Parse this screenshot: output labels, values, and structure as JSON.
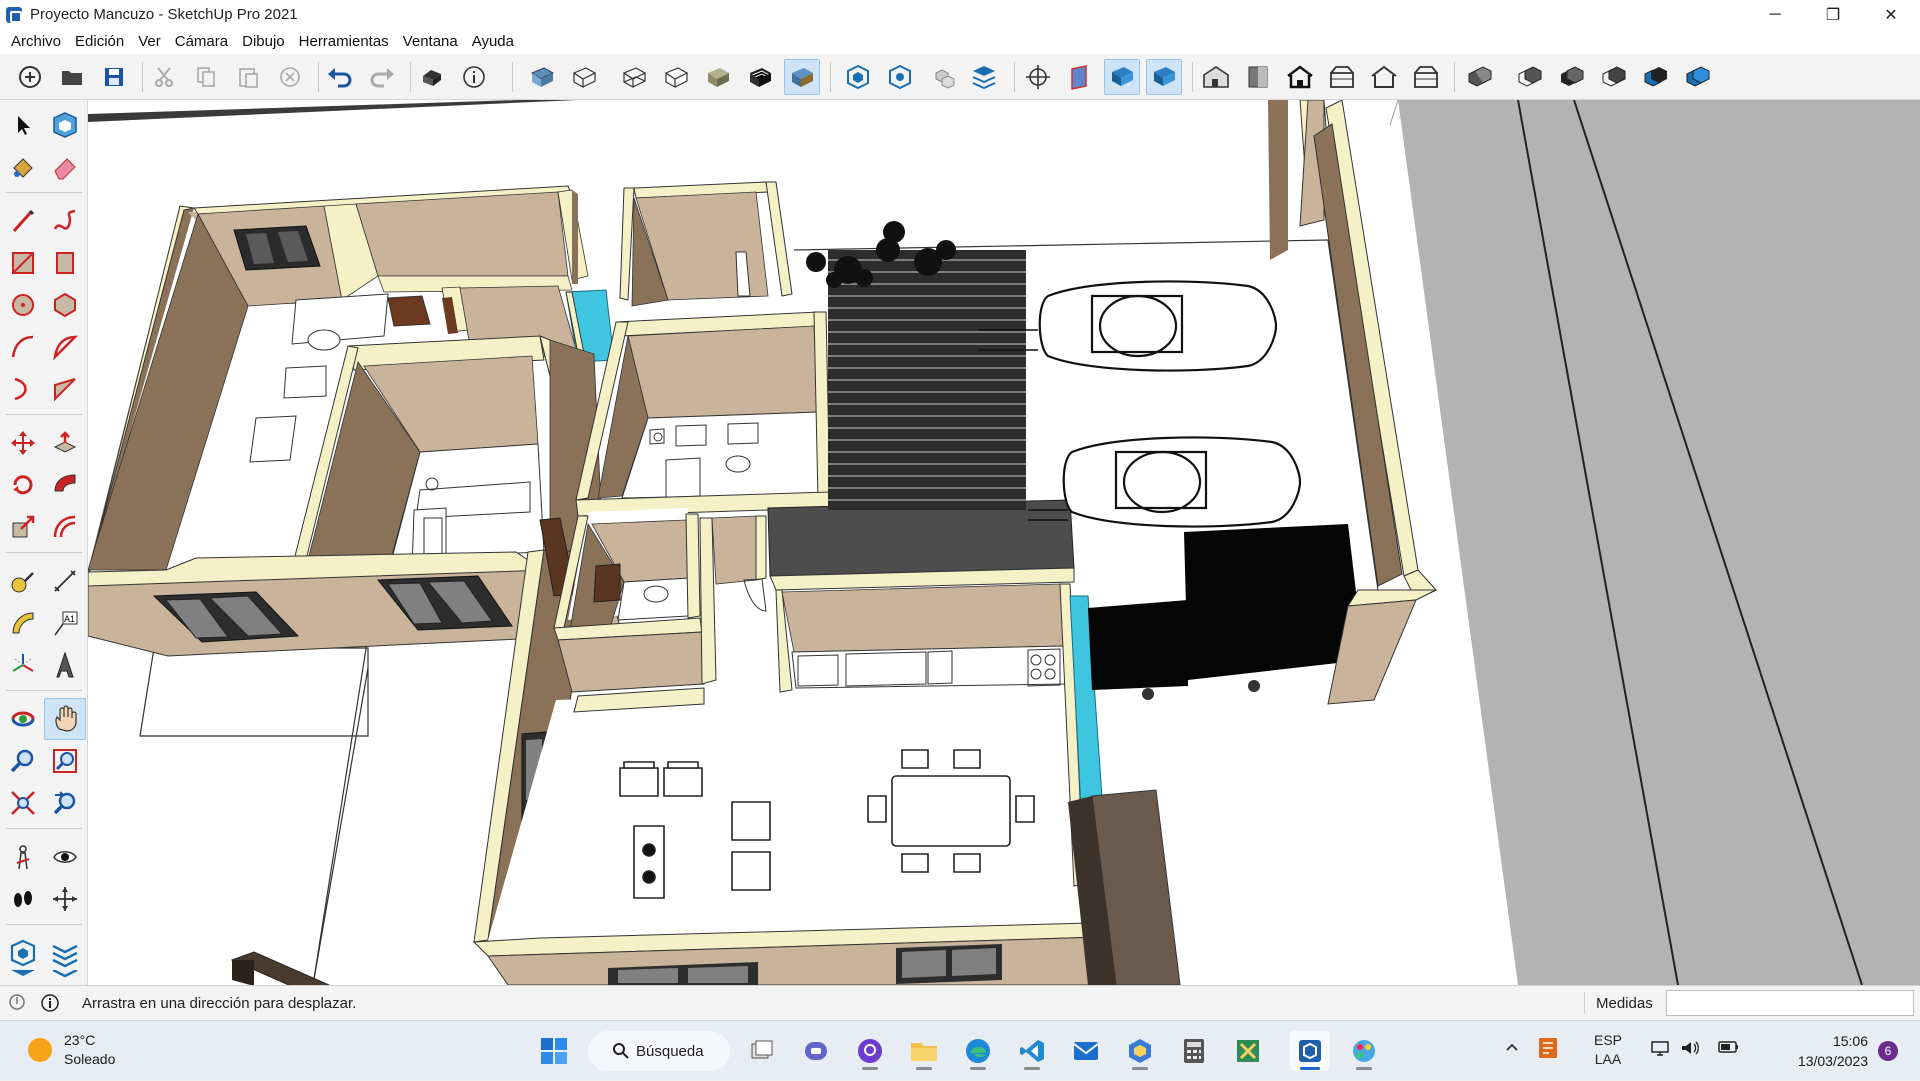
{
  "window": {
    "title": "Proyecto Mancuzo - SketchUp Pro 2021",
    "minimize": "─",
    "maximize": "❐",
    "close": "✕"
  },
  "menu": [
    "Archivo",
    "Edición",
    "Ver",
    "Cámara",
    "Dibujo",
    "Herramientas",
    "Ventana",
    "Ayuda"
  ],
  "toolbar_icons": [
    "new-icon",
    "open-icon",
    "save-icon",
    "cut-icon",
    "copy-icon",
    "paste-icon",
    "erase-icon",
    "undo-icon",
    "redo-icon",
    "print-icon",
    "model-info-icon",
    "xray-icon",
    "back-edges-icon",
    "wireframe-icon",
    "hidden-line-icon",
    "shaded-icon",
    "shaded-textures-icon",
    "monochrome-icon",
    "component-icon",
    "component-options-icon",
    "component-attributes-icon",
    "layers-icon",
    "axes-icon",
    "section-plane-icon",
    "section-display-icon",
    "section-cuts-icon",
    "iso-view-icon",
    "top-view-icon",
    "front-view-icon",
    "right-view-icon",
    "back-view-icon",
    "left-view-icon",
    "union-icon",
    "intersect-icon",
    "subtract-icon",
    "trim-icon",
    "split-icon",
    "outer-shell-icon"
  ],
  "left_tools": [
    "select-icon",
    "make-component-icon",
    "paint-bucket-icon",
    "eraser-icon",
    "line-icon",
    "freehand-icon",
    "rectangle-icon",
    "rotated-rectangle-icon",
    "circle-icon",
    "polygon-icon",
    "arc-icon",
    "pie-icon",
    "two-point-arc-icon",
    "three-point-arc-icon",
    "move-icon",
    "push-pull-icon",
    "rotate-icon",
    "follow-me-icon",
    "scale-icon",
    "offset-icon",
    "tape-measure-icon",
    "dimension-icon",
    "protractor-icon",
    "text-icon",
    "axes-icon",
    "3d-text-icon",
    "orbit-icon",
    "pan-icon",
    "zoom-icon",
    "zoom-window-icon",
    "zoom-extents-icon",
    "previous-view-icon",
    "position-camera-icon",
    "look-around-icon",
    "walk-icon",
    "section-plane-icon",
    "solid-tools-icon",
    "solid-tools-2-icon",
    "solid-tools-3-icon",
    "solid-tools-4-icon"
  ],
  "status": {
    "hint": "Arrastra en una dirección para desplazar.",
    "measurements_label": "Medidas",
    "measurements_value": ""
  },
  "taskbar": {
    "weather_temp": "23°C",
    "weather_desc": "Soleado",
    "search_label": "Búsqueda",
    "lang_top": "ESP",
    "lang_bottom": "LAA",
    "time": "15:06",
    "date": "13/03/2023",
    "notifications": "6"
  },
  "colors": {
    "wall_cream": "#f6f0c6",
    "wall_tan": "#c9b49b",
    "wall_dark": "#8a7259",
    "glass_blue": "#3ec6e0",
    "road_gray": "#b3b3b3",
    "accent_blue": "#1e66c8"
  }
}
